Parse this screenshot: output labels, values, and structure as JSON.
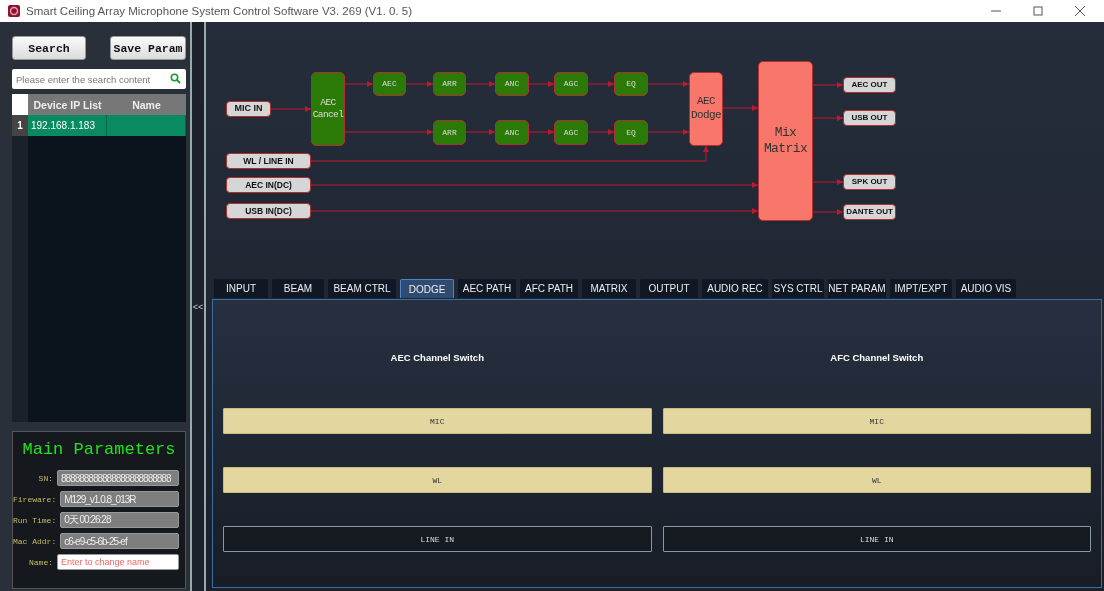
{
  "window": {
    "title": "Smart Ceiling Array Microphone System Control Software V3. 269 (V1. 0. 5)"
  },
  "sidebar": {
    "buttons": [
      "Search",
      "Save Param"
    ],
    "search": {
      "placeholder": "Please enter the search content"
    },
    "device_table": {
      "columns": [
        "Device IP List",
        "Name"
      ],
      "rows": [
        {
          "index": "1",
          "ip": "192.168.1.183",
          "name": "",
          "selected": true
        }
      ]
    },
    "main_parameters": {
      "title": "Main Parameters",
      "fields": [
        {
          "label": "SN:",
          "value": "888888888888888888888888",
          "kind": "readout"
        },
        {
          "label": "Fireware:",
          "value": "M129_v1.0.8_013R",
          "kind": "readout"
        },
        {
          "label": "Run Time:",
          "value": "0天 00:26:28",
          "kind": "readout"
        },
        {
          "label": "Mac Addr:",
          "value": "c6-e9-c5-6b-25-ef",
          "kind": "readout"
        },
        {
          "label": "Name:",
          "placeholder": "Enter to change name",
          "kind": "input"
        }
      ]
    }
  },
  "splitter": {
    "label": "<<"
  },
  "diagram": {
    "nodes": [
      {
        "label": "MIC IN",
        "kind": "port"
      },
      {
        "label": "AEC Cancel",
        "kind": "block"
      },
      {
        "label": "AEC",
        "kind": "block"
      },
      {
        "label": "ARR",
        "kind": "block"
      },
      {
        "label": "ANC",
        "kind": "block"
      },
      {
        "label": "AGC",
        "kind": "block"
      },
      {
        "label": "EQ",
        "kind": "block"
      },
      {
        "label": "ARR",
        "kind": "block"
      },
      {
        "label": "ANC",
        "kind": "block"
      },
      {
        "label": "AGC",
        "kind": "block"
      },
      {
        "label": "EQ",
        "kind": "block"
      },
      {
        "label": "AEC Dodge",
        "kind": "mixer"
      },
      {
        "label": "Mix Matrix",
        "kind": "mixer"
      },
      {
        "label": "WL / LINE IN",
        "kind": "port"
      },
      {
        "label": "AEC IN(DC)",
        "kind": "port"
      },
      {
        "label": "USB IN(DC)",
        "kind": "port"
      },
      {
        "label": "AEC OUT",
        "kind": "port"
      },
      {
        "label": "USB OUT",
        "kind": "port"
      },
      {
        "label": "SPK OUT",
        "kind": "port"
      },
      {
        "label": "DANTE OUT",
        "kind": "port"
      }
    ]
  },
  "tabs": [
    {
      "label": "INPUT",
      "selected": false
    },
    {
      "label": "BEAM",
      "selected": false
    },
    {
      "label": "BEAM CTRL",
      "selected": false
    },
    {
      "label": "DODGE",
      "selected": true
    },
    {
      "label": "AEC PATH",
      "selected": false
    },
    {
      "label": "AFC PATH",
      "selected": false
    },
    {
      "label": "MATRIX",
      "selected": false
    },
    {
      "label": "OUTPUT",
      "selected": false
    },
    {
      "label": "AUDIO REC",
      "selected": false
    },
    {
      "label": "SYS CTRL",
      "selected": false
    },
    {
      "label": "NET PARAM",
      "selected": false
    },
    {
      "label": "IMPT/EXPT",
      "selected": false
    },
    {
      "label": "AUDIO VIS",
      "selected": false
    }
  ],
  "dodge": {
    "groups": [
      {
        "title": "AEC Channel Switch",
        "switches": [
          {
            "label": "MIC",
            "on": true
          },
          {
            "label": "WL",
            "on": true
          },
          {
            "label": "LINE IN",
            "on": false
          }
        ]
      },
      {
        "title": "AFC Channel Switch",
        "switches": [
          {
            "label": "MIC",
            "on": true
          },
          {
            "label": "WL",
            "on": true
          },
          {
            "label": "LINE IN",
            "on": false
          }
        ]
      }
    ]
  }
}
